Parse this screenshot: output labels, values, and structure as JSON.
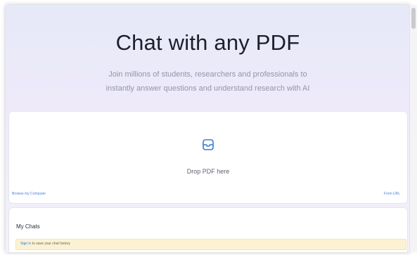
{
  "hero": {
    "title": "Chat with any PDF",
    "subtitle_line1": "Join millions of students, researchers and professionals to",
    "subtitle_line2": "instantly answer questions and understand research with AI"
  },
  "upload": {
    "icon": "inbox-icon",
    "drop_label": "Drop PDF here",
    "browse_label": "Browse my Computer",
    "url_label": "From URL"
  },
  "chats": {
    "title": "My Chats",
    "signin_link": "Sign in",
    "signin_suffix": " to save your chat history"
  },
  "colors": {
    "accent": "#3b7ad4",
    "banner_bg": "#fcf2d3"
  }
}
